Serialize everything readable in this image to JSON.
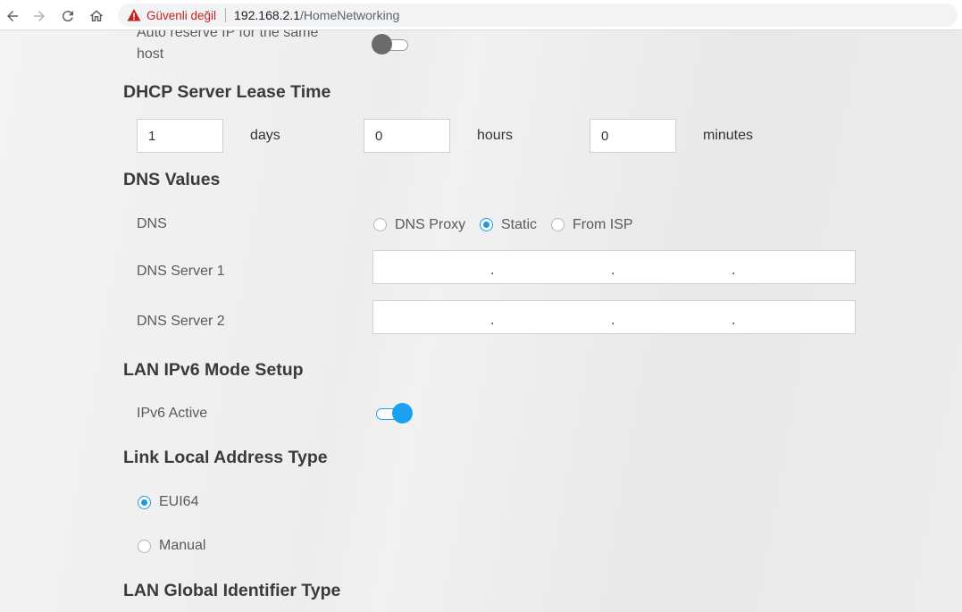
{
  "browser": {
    "security_label": "Güvenli değil",
    "url_host": "192.168.2.1",
    "url_path": "/HomeNetworking"
  },
  "auto_reserve": {
    "label_line1": "Auto reserve IP for the same",
    "label_line2": "host",
    "enabled": false
  },
  "lease": {
    "heading": "DHCP Server Lease Time",
    "days_value": "1",
    "days_label": "days",
    "hours_value": "0",
    "hours_label": "hours",
    "minutes_value": "0",
    "minutes_label": "minutes"
  },
  "dns": {
    "heading": "DNS Values",
    "mode_label": "DNS",
    "options": [
      "DNS Proxy",
      "Static",
      "From ISP"
    ],
    "selected": "Static",
    "server1_label": "DNS Server 1",
    "server2_label": "DNS Server 2",
    "ip_separator": "."
  },
  "ipv6": {
    "heading": "LAN IPv6 Mode Setup",
    "active_label": "IPv6 Active",
    "active": true
  },
  "link_local": {
    "heading": "Link Local Address Type",
    "options": [
      "EUI64",
      "Manual"
    ],
    "selected": "EUI64"
  },
  "global_id": {
    "heading": "LAN Global Identifier Type"
  },
  "colors": {
    "accent": "#1aa1f0",
    "insecure": "#c5221f"
  }
}
